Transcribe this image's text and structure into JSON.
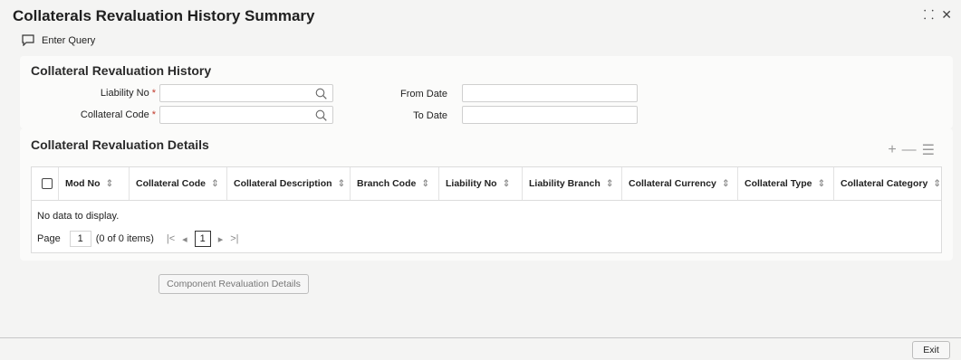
{
  "window": {
    "title": "Collaterals Revaluation History Summary",
    "minimize_glyph": "⸬",
    "close_glyph": "✕"
  },
  "toolbar": {
    "enter_query_label": "Enter Query",
    "enter_query_icon": "query-icon"
  },
  "history_panel": {
    "title": "Collateral Revaluation History",
    "liability_no_label": "Liability No",
    "collateral_code_label": "Collateral Code",
    "from_date_label": "From Date",
    "to_date_label": "To Date",
    "required_mark": "*",
    "liability_no_value": "",
    "collateral_code_value": "",
    "from_date_value": "",
    "to_date_value": ""
  },
  "details_panel": {
    "title": "Collateral Revaluation Details",
    "add_glyph": "+",
    "remove_glyph": "—",
    "columns_glyph": "☰",
    "columns": [
      "Mod No",
      "Collateral Code",
      "Collateral Description",
      "Branch Code",
      "Liability No",
      "Liability Branch",
      "Collateral Currency",
      "Collateral Type",
      "Collateral Category"
    ],
    "sort_glyph": "⇕",
    "no_data": "No data to display.",
    "pager": {
      "page_label": "Page",
      "page_value": "1",
      "items_text": "(0 of 0 items)",
      "first": "|<",
      "prev": "◂",
      "current": "1",
      "next": "▸",
      "last": ">|"
    }
  },
  "buttons": {
    "component_revaluation": "Component Revaluation Details",
    "exit": "Exit"
  },
  "colors": {
    "required": "#c0392b",
    "title": "#1f1f1f",
    "muted": "#777777"
  }
}
